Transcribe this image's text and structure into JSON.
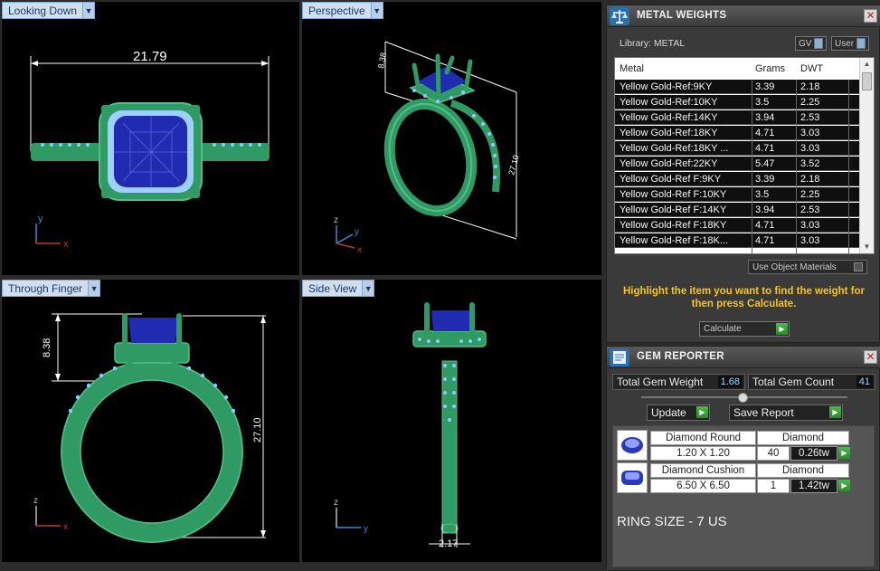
{
  "viewports": {
    "top_left": {
      "label": "Looking Down",
      "dimension": "21.79",
      "axes": [
        "y",
        "x"
      ]
    },
    "top_right": {
      "label": "Perspective",
      "dimensions": [
        "8.38",
        "27.10"
      ],
      "axes": [
        "z",
        "y",
        "x"
      ]
    },
    "bottom_left": {
      "label": "Through Finger",
      "dimensions": [
        "8.38",
        "27.10"
      ],
      "axes": [
        "z",
        "x"
      ]
    },
    "bottom_right": {
      "label": "Side View",
      "dimension": "2.17",
      "axes": [
        "z",
        "y"
      ]
    }
  },
  "metal_weights": {
    "title": "METAL WEIGHTS",
    "library_label": "Library: METAL",
    "gv_toggle": "GV",
    "user_toggle": "User",
    "headers": {
      "metal": "Metal",
      "grams": "Grams",
      "dwt": "DWT"
    },
    "rows": [
      {
        "metal": "Yellow Gold-Ref:9KY",
        "grams": "3.39",
        "dwt": "2.18"
      },
      {
        "metal": "Yellow Gold-Ref:10KY",
        "grams": "3.5",
        "dwt": "2.25"
      },
      {
        "metal": "Yellow Gold-Ref:14KY",
        "grams": "3.94",
        "dwt": "2.53"
      },
      {
        "metal": "Yellow Gold-Ref:18KY",
        "grams": "4.71",
        "dwt": "3.03"
      },
      {
        "metal": "Yellow Gold-Ref:18KY ...",
        "grams": "4.71",
        "dwt": "3.03"
      },
      {
        "metal": "Yellow Gold-Ref:22KY",
        "grams": "5.47",
        "dwt": "3.52"
      },
      {
        "metal": "Yellow Gold-Ref F:9KY",
        "grams": "3.39",
        "dwt": "2.18"
      },
      {
        "metal": "Yellow Gold-Ref F:10KY",
        "grams": "3.5",
        "dwt": "2.25"
      },
      {
        "metal": "Yellow Gold-Ref F:14KY",
        "grams": "3.94",
        "dwt": "2.53"
      },
      {
        "metal": "Yellow Gold-Ref F:18KY",
        "grams": "4.71",
        "dwt": "3.03"
      },
      {
        "metal": "Yellow Gold-Ref F:18K...",
        "grams": "4.71",
        "dwt": "3.03"
      }
    ],
    "use_object_materials": "Use Object Materials",
    "hint": "Highlight the item you want to find the weight for then press Calculate.",
    "calculate_label": "Calculate"
  },
  "gem_reporter": {
    "title": "GEM REPORTER",
    "total_weight_label": "Total Gem Weight",
    "total_weight_value": "1.68",
    "total_count_label": "Total Gem Count",
    "total_count_value": "41",
    "update_label": "Update",
    "save_report_label": "Save Report",
    "gems": [
      {
        "shape": "Diamond Round",
        "size": "1.20 X 1.20",
        "material": "Diamond",
        "count": "40",
        "weight": "0.26tw"
      },
      {
        "shape": "Diamond Cushion",
        "size": "6.50 X 6.50",
        "material": "Diamond",
        "count": "1",
        "weight": "1.42tw"
      }
    ],
    "ring_size": "RING SIZE - 7 US"
  },
  "colors": {
    "metal": "#2f9a63",
    "metal_light": "#4fc08a",
    "stone": "#2a3ab8",
    "accent_hint": "#f5c518",
    "dimension": "#ffffff"
  }
}
